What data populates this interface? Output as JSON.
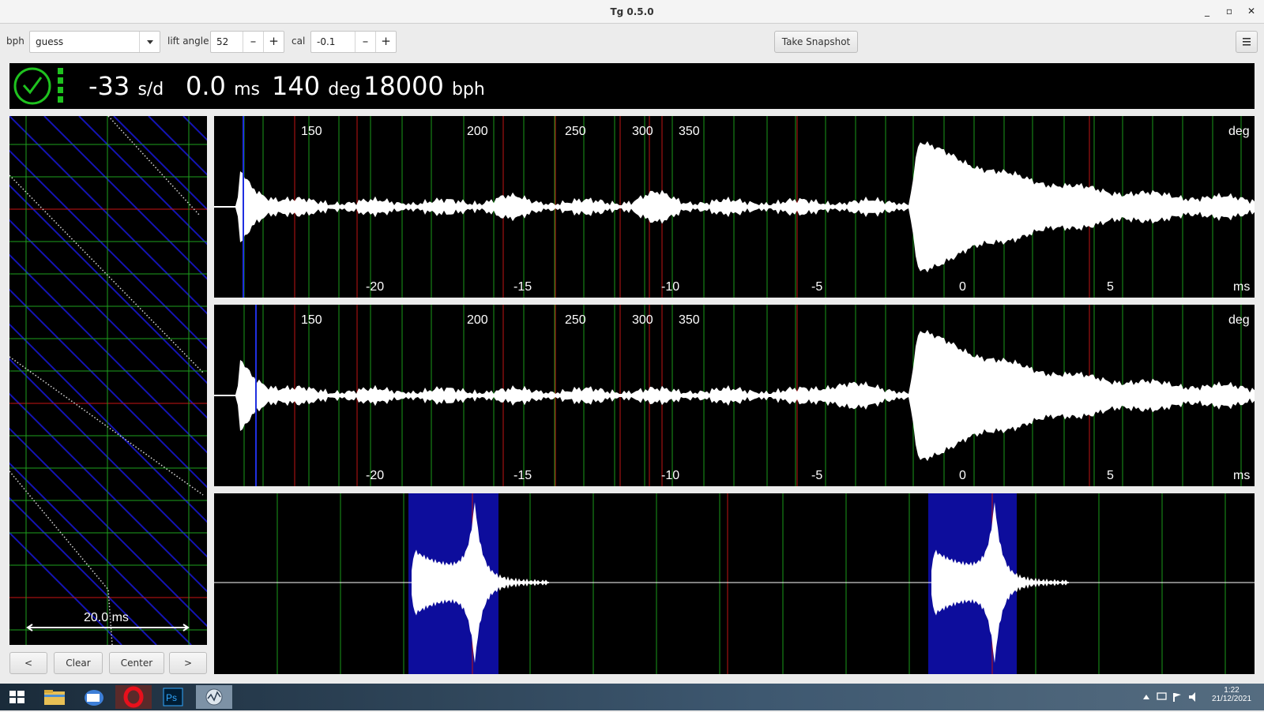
{
  "window": {
    "title": "Tg 0.5.0"
  },
  "toolbar": {
    "bph_label": "bph",
    "bph_value": "guess",
    "lift_angle_label": "lift angle",
    "lift_angle_value": "52",
    "cal_label": "cal",
    "cal_value": "-0.1",
    "minus": "–",
    "plus": "+",
    "snapshot_label": "Take Snapshot",
    "menu_icon": "hamburger-menu-icon"
  },
  "status": {
    "rate": "-33",
    "rate_unit": "s/d",
    "beat_error": "0.0",
    "beat_error_unit": "ms",
    "amplitude": "140",
    "amplitude_unit": "deg",
    "bph": "18000",
    "bph_unit": "bph",
    "ok_icon": "checkmark-circle-icon",
    "signal_icon": "signal-level-icon",
    "colors": {
      "ok": "#1fc21f"
    }
  },
  "paperstrip": {
    "scale_label": "20.0 ms",
    "buttons": {
      "prev": "<",
      "clear": "Clear",
      "center": "Center",
      "next": ">"
    }
  },
  "waveform": {
    "deg_ticks": [
      "150",
      "200",
      "250",
      "300",
      "350"
    ],
    "deg_unit": "deg",
    "ms_ticks": [
      "-20",
      "-15",
      "-10",
      "-5",
      "0",
      "5"
    ],
    "ms_unit": "ms"
  },
  "taskbar": {
    "clock_time": "1:22",
    "clock_date": "21/12/2021",
    "icons": [
      "windows-start-icon",
      "file-explorer-icon",
      "mail-icon",
      "opera-icon",
      "photoshop-icon",
      "tg-app-icon"
    ]
  }
}
